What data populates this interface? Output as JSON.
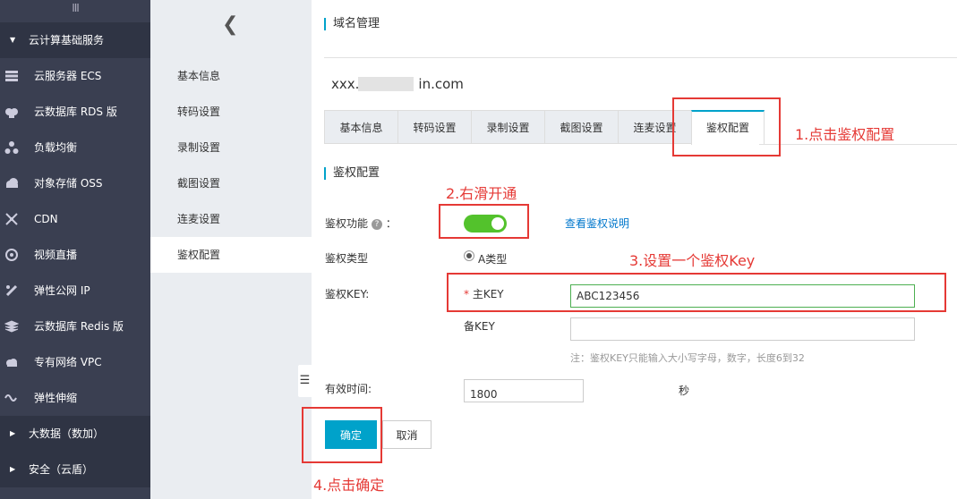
{
  "left_nav": {
    "grip": "III",
    "section_cloud": "云计算基础服务",
    "items": [
      {
        "label": "云服务器 ECS",
        "icon": "server-icon"
      },
      {
        "label": "云数据库 RDS 版",
        "icon": "database-icon"
      },
      {
        "label": "负载均衡",
        "icon": "load-balancer-icon"
      },
      {
        "label": "对象存储 OSS",
        "icon": "cloud-storage-icon"
      },
      {
        "label": "CDN",
        "icon": "cdn-icon"
      },
      {
        "label": "视频直播",
        "icon": "live-video-icon"
      },
      {
        "label": "弹性公网 IP",
        "icon": "elastic-ip-icon"
      },
      {
        "label": "云数据库 Redis 版",
        "icon": "redis-icon"
      },
      {
        "label": "专有网络 VPC",
        "icon": "vpc-icon"
      },
      {
        "label": "弹性伸缩",
        "icon": "auto-scaling-icon"
      }
    ],
    "section_bigdata": "大数据（数加）",
    "section_security": "安全（云盾）"
  },
  "sub_nav": {
    "back_icon": "chevron-left-icon",
    "items": [
      "基本信息",
      "转码设置",
      "录制设置",
      "截图设置",
      "连麦设置",
      "鉴权配置"
    ],
    "active": "鉴权配置"
  },
  "main": {
    "page_title": "域名管理",
    "domain": "xxx.",
    "domain_suffix": "in.com",
    "tabs": [
      "基本信息",
      "转码设置",
      "录制设置",
      "截图设置",
      "连麦设置",
      "鉴权配置"
    ],
    "active_tab": "鉴权配置",
    "section_title": "鉴权配置",
    "auth_function_label": "鉴权功能",
    "auth_function_colon": "：",
    "auth_enabled": true,
    "view_doc_link": "查看鉴权说明",
    "auth_type_label": "鉴权类型",
    "auth_type_option": "A类型",
    "auth_key_label": "鉴权KEY:",
    "primary_key_required": "*",
    "primary_key_label": "主KEY",
    "primary_key_value": "ABC123456",
    "backup_key_label": "备KEY",
    "backup_key_value": "",
    "key_hint": "注：鉴权KEY只能输入大小写字母，数字，长度6到32",
    "valid_time_label": "有效时间:",
    "valid_time_value": "1800",
    "valid_time_unit": "秒",
    "confirm_button": "确定",
    "cancel_button": "取消"
  },
  "annotations": {
    "step1": "1.点击鉴权配置",
    "step2": "2.右滑开通",
    "step3": "3.设置一个鉴权Key",
    "step4": "4.点击确定",
    "color": "#e53935"
  },
  "colors": {
    "accent": "#00a2ca",
    "switch_on": "#53c22c",
    "nav_bg": "#3a3f51",
    "subnav_bg": "#eaedf1"
  }
}
